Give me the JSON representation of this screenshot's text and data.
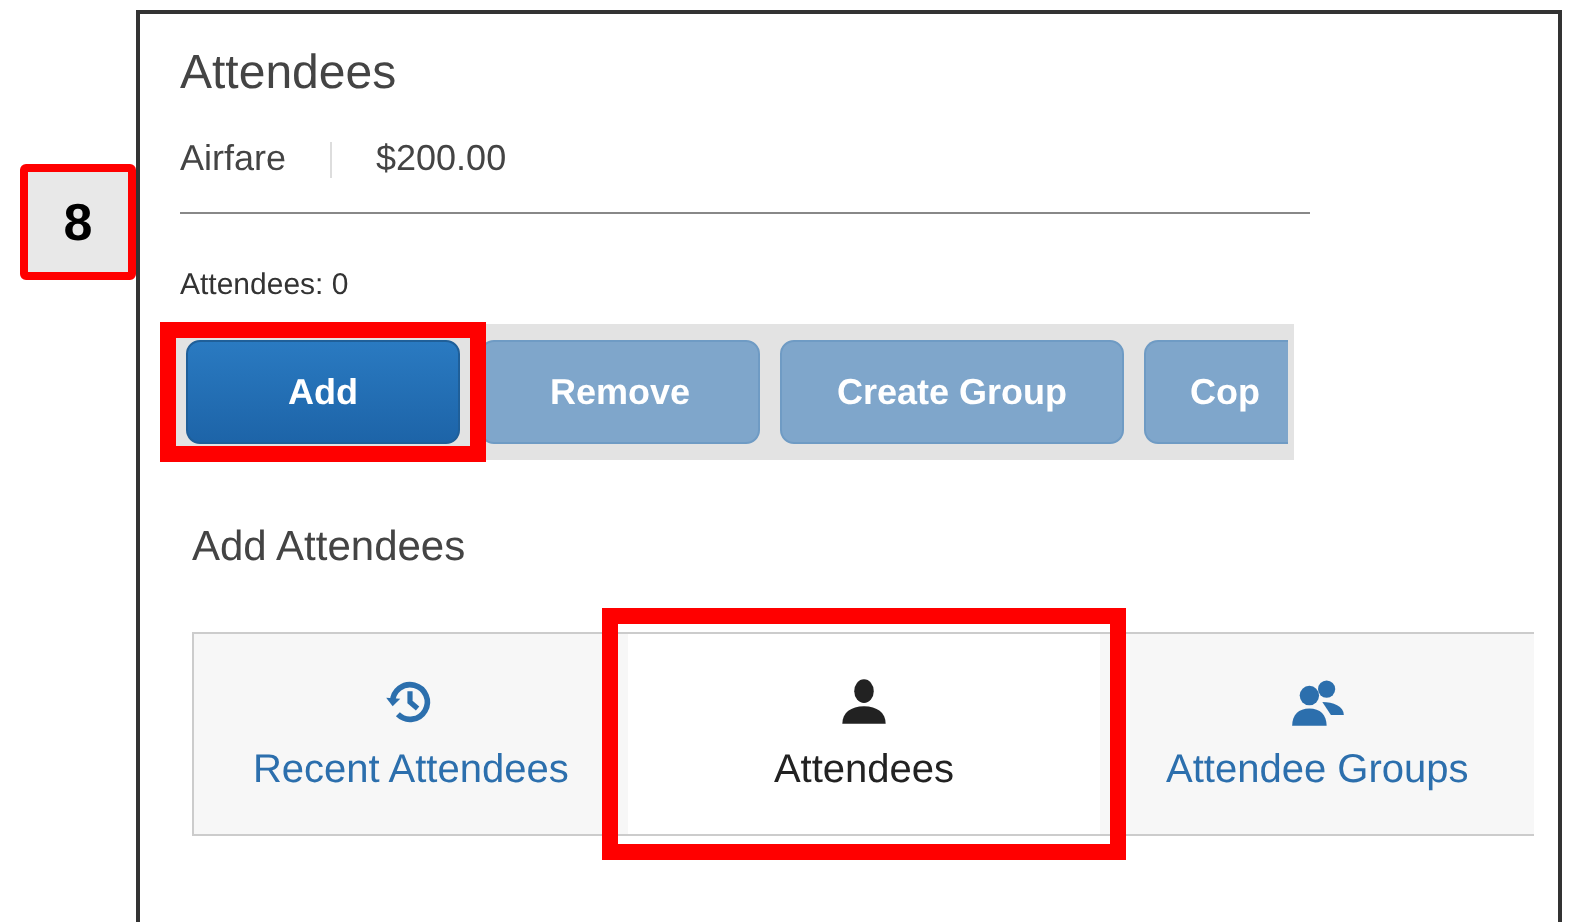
{
  "step_badge": {
    "label": "8"
  },
  "section": {
    "title": "Attendees",
    "expense_type": "Airfare",
    "amount": "$200.00",
    "count_label": "Attendees: 0"
  },
  "buttons": [
    {
      "label": "Add",
      "disabled": false,
      "highlighted": true
    },
    {
      "label": "Remove",
      "disabled": true,
      "highlighted": false
    },
    {
      "label": "Create Group",
      "disabled": true,
      "highlighted": false
    },
    {
      "label": "Cop",
      "disabled": true,
      "highlighted": false
    }
  ],
  "add_section": {
    "title": "Add Attendees"
  },
  "tabs": [
    {
      "label": "Recent Attendees",
      "kind": "history",
      "selected": false,
      "highlighted": false
    },
    {
      "label": "Attendees",
      "kind": "person",
      "selected": true,
      "highlighted": true
    },
    {
      "label": "Attendee Groups",
      "kind": "people",
      "selected": false,
      "highlighted": false
    }
  ]
}
